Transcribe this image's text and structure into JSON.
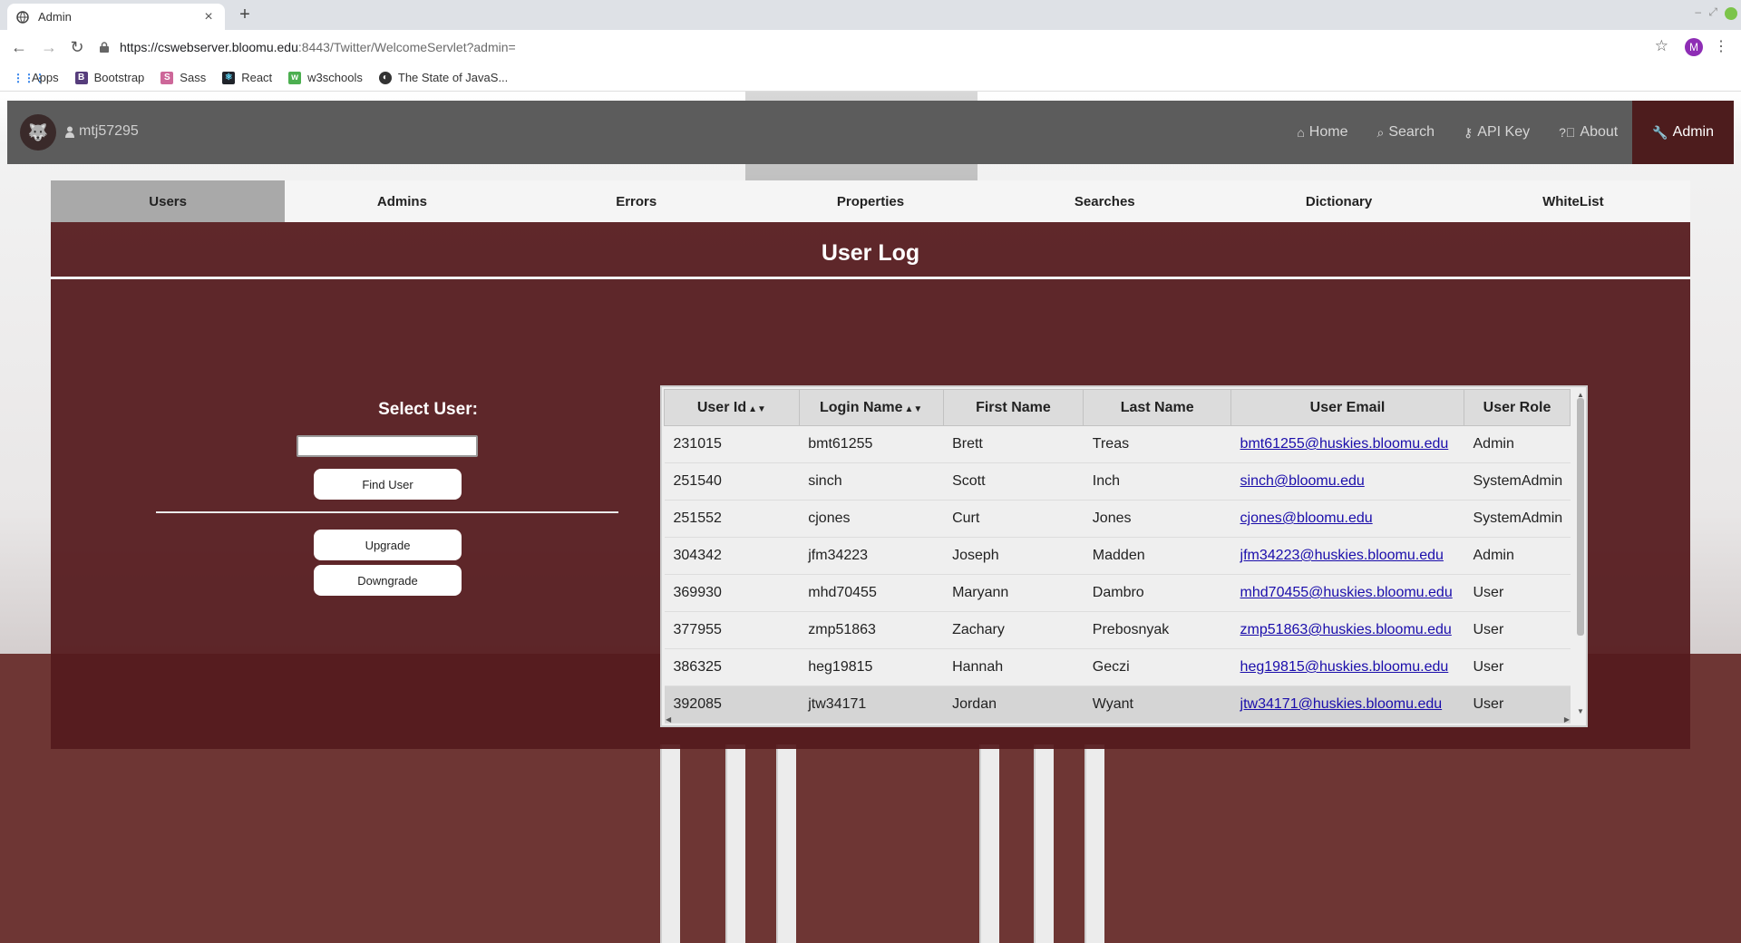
{
  "browser": {
    "tab_title": "Admin",
    "tab_close": "×",
    "new_tab": "+",
    "url_host": "https://cswebserver.bloomu.edu",
    "url_rest": ":8443/Twitter/WelcomeServlet?admin=",
    "profile_initial": "M",
    "bookmarks": [
      "Apps",
      "Bootstrap",
      "Sass",
      "React",
      "w3schools",
      "The State of JavaS..."
    ]
  },
  "navbar": {
    "username": "mtj57295",
    "links": [
      {
        "label": "Home",
        "icon": "home-icon"
      },
      {
        "label": "Search",
        "icon": "search-icon"
      },
      {
        "label": "API Key",
        "icon": "key-icon"
      },
      {
        "label": "About",
        "icon": "question-icon"
      },
      {
        "label": "Admin",
        "icon": "wrench-icon"
      }
    ]
  },
  "subtabs": [
    "Users",
    "Admins",
    "Errors",
    "Properties",
    "Searches",
    "Dictionary",
    "WhiteList"
  ],
  "main": {
    "title": "User Log",
    "select_label": "Select User:",
    "search_value": "",
    "find_button": "Find User",
    "upgrade_button": "Upgrade",
    "downgrade_button": "Downgrade"
  },
  "table": {
    "headers": [
      "User Id",
      "Login Name",
      "First Name",
      "Last Name",
      "User Email",
      "User Role"
    ],
    "rows": [
      [
        "231015",
        "bmt61255",
        "Brett",
        "Treas",
        "bmt61255@huskies.bloomu.edu",
        "Admin"
      ],
      [
        "251540",
        "sinch",
        "Scott",
        "Inch",
        "sinch@bloomu.edu",
        "SystemAdmin"
      ],
      [
        "251552",
        "cjones",
        "Curt",
        "Jones",
        "cjones@bloomu.edu",
        "SystemAdmin"
      ],
      [
        "304342",
        "jfm34223",
        "Joseph",
        "Madden",
        "jfm34223@huskies.bloomu.edu",
        "Admin"
      ],
      [
        "369930",
        "mhd70455",
        "Maryann",
        "Dambro",
        "mhd70455@huskies.bloomu.edu",
        "User"
      ],
      [
        "377955",
        "zmp51863",
        "Zachary",
        "Prebosnyak",
        "zmp51863@huskies.bloomu.edu",
        "User"
      ],
      [
        "386325",
        "heg19815",
        "Hannah",
        "Geczi",
        "heg19815@huskies.bloomu.edu",
        "User"
      ],
      [
        "392085",
        "jtw34171",
        "Jordan",
        "Wyant",
        "jtw34171@huskies.bloomu.edu",
        "User"
      ]
    ]
  },
  "colors": {
    "panel": "#551b1e",
    "navbar": "#5c5c5c",
    "active_nav": "#4d1c1d",
    "link": "#1a0dab"
  }
}
